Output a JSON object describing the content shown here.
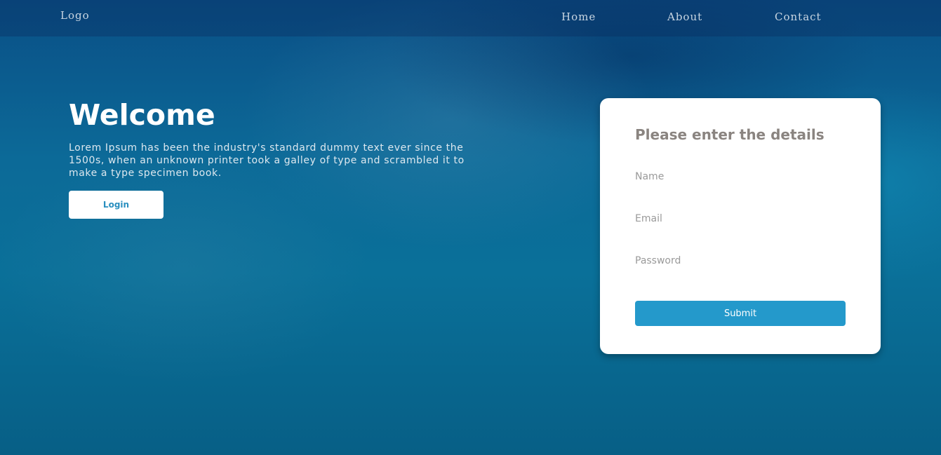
{
  "nav": {
    "logo": "Logo",
    "links": [
      "Home",
      "About",
      "Contact"
    ]
  },
  "hero": {
    "title": "Welcome",
    "text": "Lorem Ipsum has been the industry's standard dummy text ever since the 1500s, when an unknown printer took a galley of type and scrambled it to make a type specimen book.",
    "login_label": "Login"
  },
  "form": {
    "title": "Please enter the details",
    "name_placeholder": "Name",
    "name_value": "",
    "email_placeholder": "Email",
    "email_value": "",
    "password_placeholder": "Password",
    "password_value": "",
    "submit_label": "Submit"
  },
  "colors": {
    "accent": "#2499cb",
    "login_text": "#2a8fbf",
    "form_title": "#8a8480",
    "background": "#0a6a98"
  }
}
